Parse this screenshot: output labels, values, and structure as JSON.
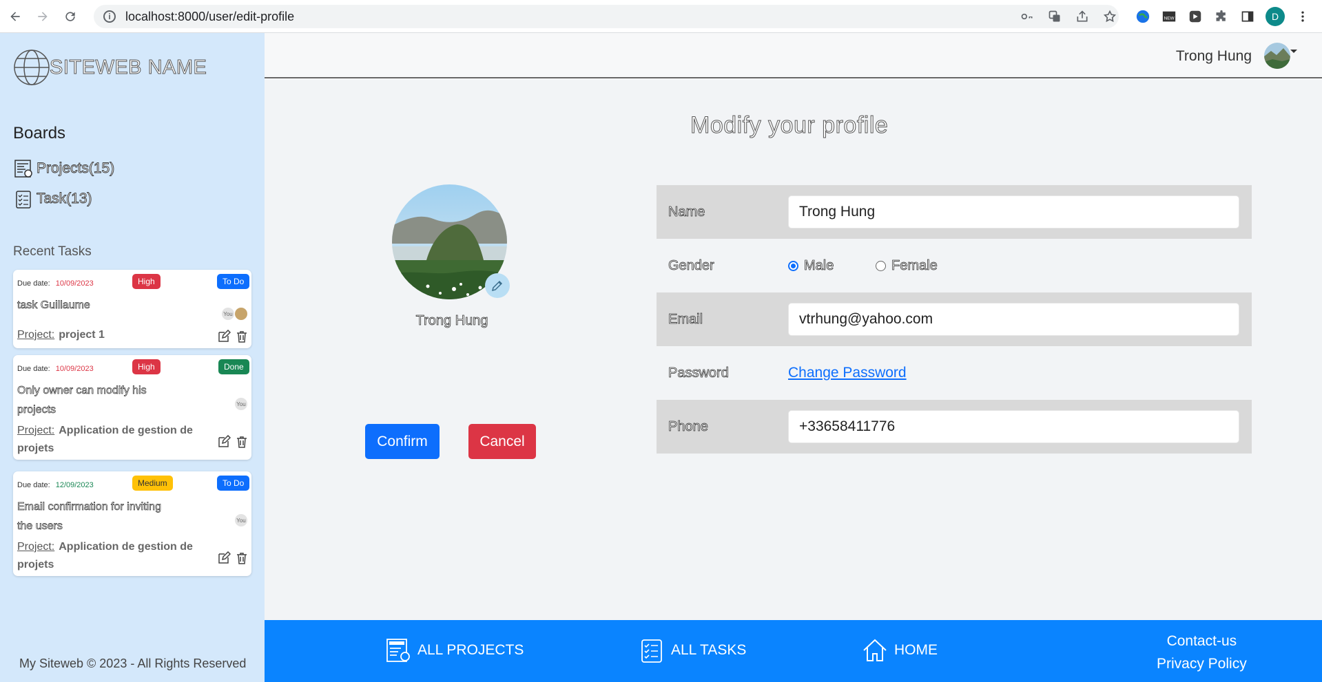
{
  "browser": {
    "url": "localhost:8000/user/edit-profile",
    "profile_initial": "D"
  },
  "sidebar": {
    "logo_text": "SITEWEB NAME",
    "boards_title": "Boards",
    "projects_link": "Projects(15)",
    "tasks_link": "Task(13)",
    "recent_title": "Recent Tasks",
    "copyright": "My Siteweb © 2023 - All Rights Reserved"
  },
  "tasks": [
    {
      "due_label": "Due date:",
      "due_date": "10/09/2023",
      "due_color": "#dc3545",
      "priority": "High",
      "priority_color": "#dc3545",
      "status": "To Do",
      "status_color": "#0d6efd",
      "name": "task Guillaume",
      "assignee": "You",
      "project_label": "Project:",
      "project": "project 1"
    },
    {
      "due_label": "Due date:",
      "due_date": "10/09/2023",
      "due_color": "#dc3545",
      "priority": "High",
      "priority_color": "#dc3545",
      "status": "Done",
      "status_color": "#198754",
      "name": "Only owner can modify his projects",
      "assignee": "You",
      "project_label": "Project:",
      "project": "Application de gestion de projets"
    },
    {
      "due_label": "Due date:",
      "due_date": "12/09/2023",
      "due_color": "#198754",
      "priority": "Medium",
      "priority_color": "#ffc107",
      "status": "To Do",
      "status_color": "#0d6efd",
      "name": "Email confirmation for inviting the users",
      "assignee": "You",
      "project_label": "Project:",
      "project": "Application de gestion de projets"
    }
  ],
  "header": {
    "user_name": "Trong Hung"
  },
  "main": {
    "page_title": "Modify your profile",
    "profile_name": "Trong Hung",
    "confirm_label": "Confirm",
    "cancel_label": "Cancel"
  },
  "form": {
    "name_label": "Name",
    "name_value": "Trong Hung",
    "gender_label": "Gender",
    "gender_male": "Male",
    "gender_female": "Female",
    "gender_selected": "Male",
    "email_label": "Email",
    "email_value": "vtrhung@yahoo.com",
    "password_label": "Password",
    "password_link": "Change Password",
    "phone_label": "Phone",
    "phone_value": "+33658411776"
  },
  "footer": {
    "all_projects": "ALL PROJECTS",
    "all_tasks": "ALL TASKS",
    "home": "HOME",
    "contact": "Contact-us",
    "privacy": "Privacy Policy"
  }
}
